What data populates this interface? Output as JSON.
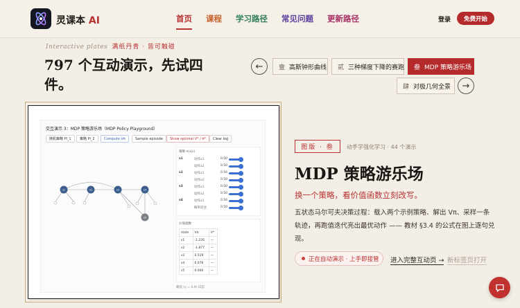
{
  "nav": {
    "brand": "灵课本",
    "brand_ai": "AI",
    "links": [
      {
        "label": "首页",
        "active": true
      },
      {
        "label": "课程"
      },
      {
        "label": "学习路径"
      },
      {
        "label": "常见问题"
      },
      {
        "label": "更新路径"
      }
    ],
    "login": "登录",
    "start": "免费开始"
  },
  "hero": {
    "eyebrow_en": "Interactive plates",
    "eyebrow_zh": "满纸丹青 · 皆可触碰",
    "title": "797 个互动演示，先试四件。"
  },
  "tabs": [
    {
      "num": "壹",
      "label": "高斯钟形曲线"
    },
    {
      "num": "贰",
      "label": "三种梯度下降的赛跑"
    },
    {
      "num": "叁",
      "label": "MDP 策略游乐场",
      "active": true
    },
    {
      "num": "肆",
      "label": "对极几何全景"
    }
  ],
  "arrows": {
    "prev": "←",
    "next": "→"
  },
  "screenshot": {
    "title": "交互演示 3：MDP 策略游乐场（MDP Policy Playground）",
    "buttons": [
      "随机策略 Pi_1",
      "策略 Pi_2",
      "Compute Vπ",
      "Sample episode",
      "Show optimal V* / π*",
      "Clear log"
    ],
    "nodes": [
      "s1",
      "s2",
      "s3",
      "s4",
      "s5"
    ],
    "policy_head": "策略 π(a|s)",
    "policy_rows": [
      {
        "s": "s1",
        "a": "动作a1",
        "v": "0.50"
      },
      {
        "s": "",
        "a": "动作a2",
        "v": "0.50"
      },
      {
        "s": "s2",
        "a": "动作a1",
        "v": "0.50"
      },
      {
        "s": "",
        "a": "动作a2",
        "v": "0.50"
      },
      {
        "s": "s3",
        "a": "动作a1",
        "v": "0.50"
      },
      {
        "s": "",
        "a": "动作a2",
        "v": "0.50"
      },
      {
        "s": "s4",
        "a": "动作a1",
        "v": "0.50"
      },
      {
        "s": "",
        "a": "概率前往",
        "v": "0.50"
      }
    ],
    "value_head": "价值函数",
    "value_cols": [
      "state",
      "Vπ",
      "V*"
    ],
    "value_rows": [
      [
        "s1",
        "-1.226",
        "—"
      ],
      [
        "s2",
        "-1.877",
        "—"
      ],
      [
        "s3",
        "0.519",
        "—"
      ],
      [
        "s4",
        "6.076",
        "—"
      ],
      [
        "s5",
        "0.000",
        "—"
      ]
    ],
    "foot": "最优 (γ = 0.9) 日志"
  },
  "detail": {
    "badge": "图版 · 叁",
    "meta": "动手学强化学习 · 44 个演示",
    "title": "MDP 策略游乐场",
    "subtitle": "换一个策略，看价值函数立刻改写。",
    "desc": "五状态马尔可夫决策过程：载入两个示例策略、解出 Vπ、采样一条轨迹，再跑值迭代亮出最优动作 —— 教材 §3.4 的公式在图上逐句兑现。",
    "autoplay": "正在自动演示 · 上手即接管",
    "enter": "进入完整互动页 →",
    "newtab": "新标签页打开"
  }
}
